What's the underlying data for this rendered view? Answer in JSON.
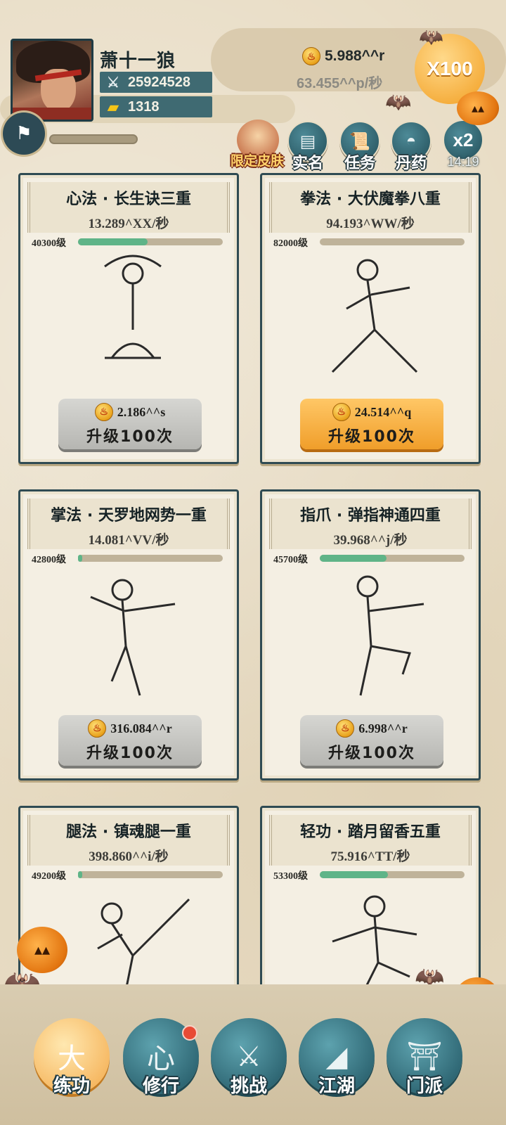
{
  "player": {
    "name": "萧十一狼",
    "power": "25924528",
    "gold": "1318",
    "exp_progress": 0
  },
  "currency": {
    "amount": "5.988^^r",
    "rate": "63.455^^p/秒",
    "multiplier": "X100"
  },
  "header_buttons": {
    "skin": "限定皮肤",
    "realname": "实名",
    "task": "任务",
    "pill": "丹药",
    "boost": "x2",
    "boost_timer": "14:19"
  },
  "cards": [
    {
      "title": "心法 · 长生诀三重",
      "rate": "13.289^XX/秒",
      "level": "40300级",
      "progress": 0.48,
      "cost": "2.186^^s",
      "upgrade": "升级100次",
      "active": false
    },
    {
      "title": "拳法 · 大伏魔拳八重",
      "rate": "94.193^WW/秒",
      "level": "82000级",
      "progress": 0.0,
      "cost": "24.514^^q",
      "upgrade": "升级100次",
      "active": true
    },
    {
      "title": "掌法 · 天罗地网势一重",
      "rate": "14.081^VV/秒",
      "level": "42800级",
      "progress": 0.03,
      "cost": "316.084^^r",
      "upgrade": "升级100次",
      "active": false
    },
    {
      "title": "指爪 · 弹指神通四重",
      "rate": "39.968^^j/秒",
      "level": "45700级",
      "progress": 0.46,
      "cost": "6.998^^r",
      "upgrade": "升级100次",
      "active": false
    },
    {
      "title": "腿法 · 镇魂腿一重",
      "rate": "398.860^^i/秒",
      "level": "49200级",
      "progress": 0.03,
      "cost": "",
      "upgrade": "",
      "active": false
    },
    {
      "title": "轻功 · 踏月留香五重",
      "rate": "75.916^TT/秒",
      "level": "53300级",
      "progress": 0.47,
      "cost": "",
      "upgrade": "",
      "active": false
    }
  ],
  "nav": {
    "items": [
      {
        "label": "练功",
        "icon": "martial-figure-icon",
        "active": true
      },
      {
        "label": "修行",
        "icon": "heart-char-icon",
        "active": false,
        "badge": true
      },
      {
        "label": "挑战",
        "icon": "crossed-swords-icon",
        "active": false
      },
      {
        "label": "江湖",
        "icon": "mountain-icon",
        "active": false
      },
      {
        "label": "门派",
        "icon": "gate-icon",
        "active": false
      }
    ]
  },
  "colors": {
    "background": "#e8dcc4",
    "accent_teal": "#2e5e69",
    "active_orange": "#f09e2a",
    "progress_green": "#5fb488"
  }
}
